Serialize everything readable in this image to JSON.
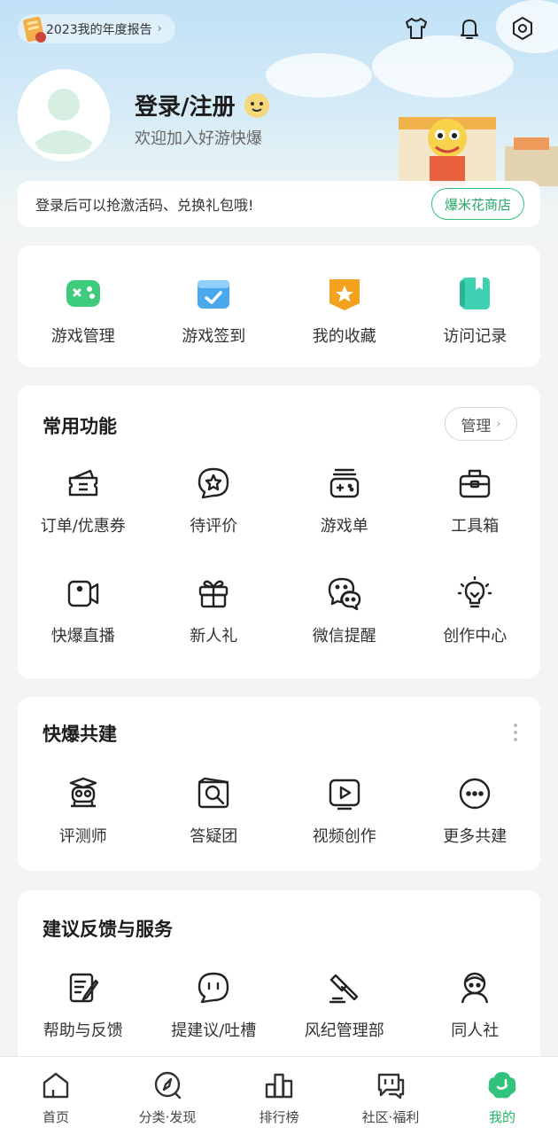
{
  "header": {
    "report_label": "2023我的年度报告",
    "login_title": "登录/注册",
    "login_subtitle": "欢迎加入好游快爆",
    "promo_text": "登录后可以抢激活码、兑换礼包哦!",
    "shop_button": "爆米花商店"
  },
  "quick_access": [
    {
      "label": "游戏管理",
      "icon": "gamepad-icon"
    },
    {
      "label": "游戏签到",
      "icon": "calendar-check-icon"
    },
    {
      "label": "我的收藏",
      "icon": "star-bookmark-icon"
    },
    {
      "label": "访问记录",
      "icon": "book-icon"
    }
  ],
  "common": {
    "title": "常用功能",
    "manage_label": "管理",
    "items": [
      {
        "label": "订单/优惠券",
        "icon": "coupon-icon"
      },
      {
        "label": "待评价",
        "icon": "review-star-icon"
      },
      {
        "label": "游戏单",
        "icon": "game-list-icon"
      },
      {
        "label": "工具箱",
        "icon": "toolbox-icon"
      },
      {
        "label": "快爆直播",
        "icon": "video-camera-icon"
      },
      {
        "label": "新人礼",
        "icon": "gift-icon"
      },
      {
        "label": "微信提醒",
        "icon": "wechat-icon"
      },
      {
        "label": "创作中心",
        "icon": "lightbulb-icon"
      }
    ]
  },
  "cobuild": {
    "title": "快爆共建",
    "items": [
      {
        "label": "评测师",
        "icon": "reviewer-icon"
      },
      {
        "label": "答疑团",
        "icon": "qa-search-icon"
      },
      {
        "label": "视频创作",
        "icon": "video-play-icon"
      },
      {
        "label": "更多共建",
        "icon": "more-circle-icon"
      }
    ]
  },
  "feedback": {
    "title": "建议反馈与服务",
    "items": [
      {
        "label": "帮助与反馈",
        "icon": "help-doc-icon"
      },
      {
        "label": "提建议/吐槽",
        "icon": "chat-bubble-icon"
      },
      {
        "label": "风纪管理部",
        "icon": "gavel-icon"
      },
      {
        "label": "同人社",
        "icon": "fan-art-icon"
      }
    ]
  },
  "tabbar": [
    {
      "label": "首页",
      "icon": "home-icon"
    },
    {
      "label": "分类·发现",
      "icon": "compass-icon"
    },
    {
      "label": "排行榜",
      "icon": "ranking-icon"
    },
    {
      "label": "社区·福利",
      "icon": "community-icon"
    },
    {
      "label": "我的",
      "icon": "profile-active-icon"
    }
  ],
  "colors": {
    "accent": "#31c27c",
    "background": "#f3f5f4"
  }
}
